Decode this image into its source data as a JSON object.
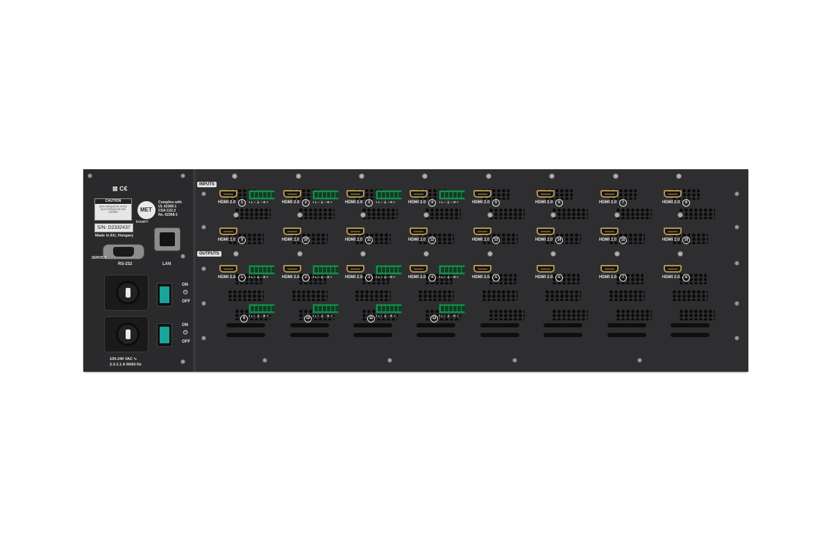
{
  "device": {
    "section_inputs": "INPUTS",
    "section_outputs": "OUTPUTS",
    "port_label": "HDMI 2.0",
    "input_row1": [
      "1",
      "2",
      "3",
      "4",
      "5",
      "6",
      "7",
      "8"
    ],
    "input_row2": [
      "9",
      "10",
      "11",
      "12",
      "13",
      "14",
      "15",
      "16"
    ],
    "output_row": [
      "1",
      "2",
      "3",
      "4",
      "5",
      "6",
      "7",
      "8"
    ],
    "audio_extra": [
      "9",
      "10",
      "11",
      "12"
    ],
    "terminal_pins": "+ L −  ⏚  − R +",
    "left": {
      "ce_mark": "⊠ C€",
      "caution_title": "CAUTION",
      "caution_text": "AVIS: RISQUE DE CHOC ELECTRIQUE NE PAS OUVRIR",
      "cert_logo": "MET",
      "compliance": [
        "Complies with",
        "UL 62368-1",
        "CSA C22.2",
        "No. 62368-1"
      ],
      "cert_number": "E114877",
      "serial": "S/N: D2332437",
      "made_in": "Made in EU, Hungary",
      "service": "SERVICE",
      "rs232": "RS-232",
      "lan": "LAN",
      "on": "ON",
      "off": "OFF",
      "power_rating_1": "100-240 VAC ∿",
      "power_rating_2": "2.3-1.1 A  50/60 Hz"
    }
  },
  "colors": {
    "chassis": "#2c2c2e",
    "terminal_green": "#1e8a4e",
    "hdmi_gold": "#b8964c",
    "switch_teal": "#1aa59a"
  }
}
